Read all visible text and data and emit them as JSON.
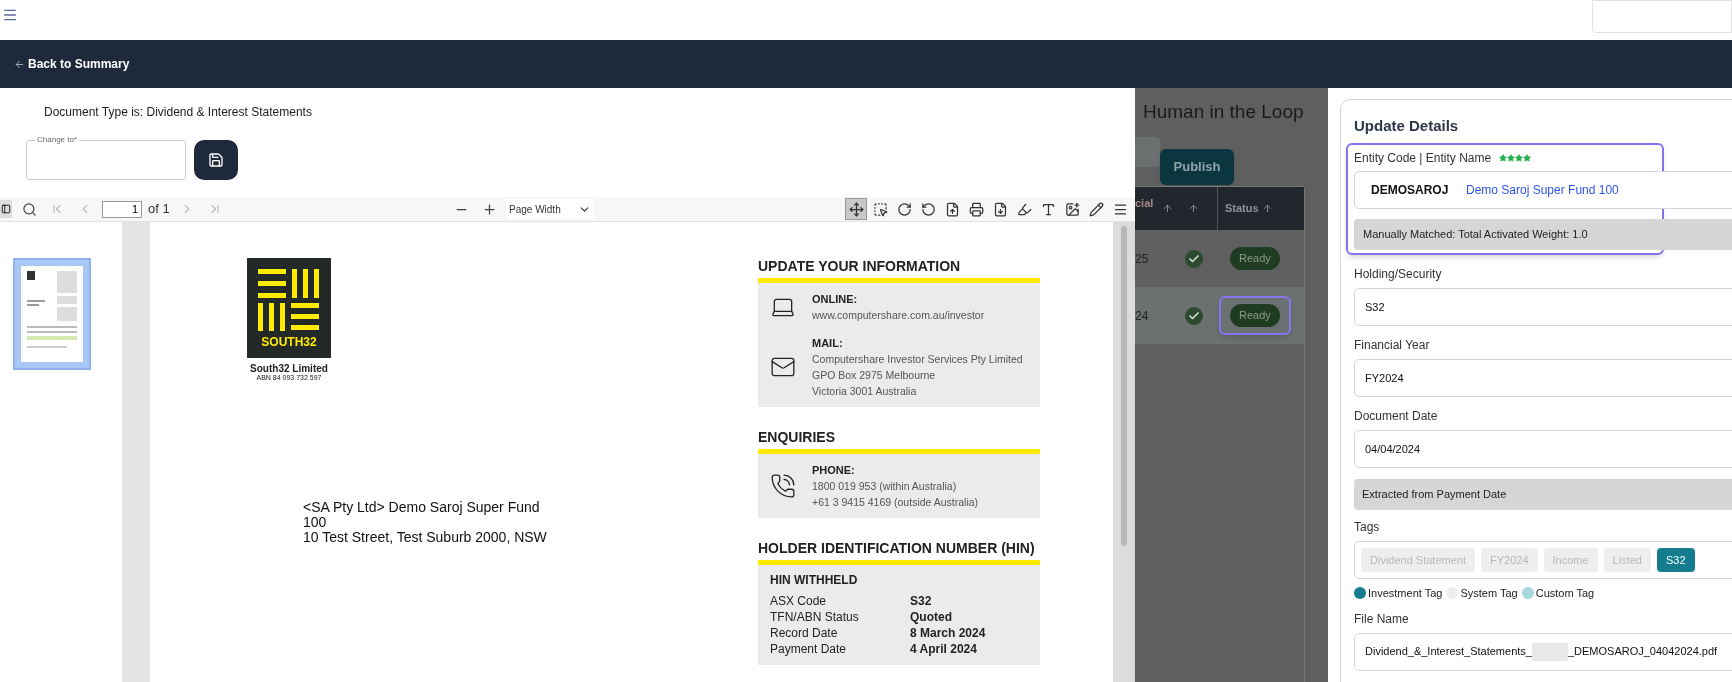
{
  "nav": {
    "back_link": "Back to Summary"
  },
  "document_type": {
    "text": "Document Type is: Dividend & Interest Statements",
    "change_to": {
      "label": "Change to*"
    }
  },
  "pdf_toolbar": {
    "page_input": "1",
    "page_count": "of 1",
    "zoom_mode": "Page Width",
    "tools": [
      {
        "kind": "pan",
        "selected": true
      },
      {
        "kind": "marquee",
        "selected": false
      },
      {
        "kind": "rotate_cw",
        "selected": false
      },
      {
        "kind": "rotate_ccw",
        "selected": false
      },
      {
        "kind": "open",
        "selected": false
      },
      {
        "kind": "print",
        "selected": false
      },
      {
        "kind": "download",
        "selected": false
      },
      {
        "kind": "highlight",
        "selected": false
      },
      {
        "kind": "text",
        "selected": false
      },
      {
        "kind": "image",
        "selected": false
      },
      {
        "kind": "draw",
        "selected": false
      },
      {
        "kind": "menu",
        "selected": false
      }
    ]
  },
  "thumbnails": [
    {
      "selected": true
    }
  ],
  "document": {
    "logo_text": "SOUTH32",
    "company": "South32 Limited",
    "abn": "ABN 84 093 732 597",
    "address_lines": [
      "<SA Pty Ltd> Demo Saroj Super Fund",
      "100",
      "10 Test Street, Test Suburb 2000, NSW"
    ],
    "sections": [
      {
        "heading": "UPDATE YOUR INFORMATION",
        "entries": [
          {
            "kind": "laptop",
            "label": "ONLINE:",
            "lines": [
              "www.computershare.com.au/investor"
            ]
          },
          {
            "kind": "mail",
            "label": "MAIL:",
            "lines": [
              "Computershare Investor Services Pty Limited",
              "GPO Box 2975 Melbourne",
              "Victoria 3001 Australia"
            ]
          }
        ]
      },
      {
        "heading": "ENQUIRIES",
        "entries": [
          {
            "kind": "phone",
            "label": "PHONE:",
            "lines": [
              "1800 019 953 (within Australia)",
              "+61 3 9415 4169 (outside Australia)"
            ]
          }
        ]
      },
      {
        "heading": "HOLDER IDENTIFICATION NUMBER (HIN)",
        "subheading": "HIN WITHHELD",
        "rows": [
          {
            "label": "ASX Code",
            "value": "S32"
          },
          {
            "label": "TFN/ABN Status",
            "value": "Quoted"
          },
          {
            "label": "Record Date",
            "value": "8 March 2024"
          },
          {
            "label": "Payment Date",
            "value": "4 April 2024"
          }
        ]
      }
    ]
  },
  "background_page": {
    "title": "Human in the Loop",
    "publish_button": "Publish",
    "table": {
      "columns": [
        "cial",
        "Status"
      ],
      "rows": [
        {
          "column_1": "25",
          "verified": true,
          "status": "Ready",
          "selected": false
        },
        {
          "column_1": "24",
          "verified": true,
          "status": "Ready",
          "selected": true
        }
      ]
    }
  },
  "update_details": {
    "title": "Update Details",
    "entity": {
      "label": "Entity Code | Entity Name",
      "stars": 4,
      "code": "DEMOSAROJ",
      "name": "Demo Saroj Super Fund 100",
      "note": "Manually Matched: Total Activated Weight: 1.0"
    },
    "fields": [
      {
        "label": "Holding/Security",
        "value": "S32"
      },
      {
        "label": "Financial Year",
        "value": "FY2024"
      },
      {
        "label": "Document Date",
        "value": "04/04/2024",
        "note": "Extracted from Payment Date"
      }
    ],
    "tags": {
      "label": "Tags",
      "items": [
        {
          "label": "Dividend Statement",
          "kind": "system"
        },
        {
          "label": "FY2024",
          "kind": "system"
        },
        {
          "label": "Income",
          "kind": "system"
        },
        {
          "label": "Listed",
          "kind": "system"
        },
        {
          "label": "S32",
          "kind": "investment"
        }
      ],
      "legend": [
        {
          "label": "Investment Tag",
          "color": "#137d8f"
        },
        {
          "label": "System Tag",
          "color": "#eeeeee"
        },
        {
          "label": "Custom Tag",
          "color": "#a9d7df"
        }
      ]
    },
    "file_name": {
      "label": "File Name",
      "value_start": "Dividend_&_Interest_Statements_",
      "value_end": "_DEMOSAROJ_04042024.pdf"
    }
  }
}
